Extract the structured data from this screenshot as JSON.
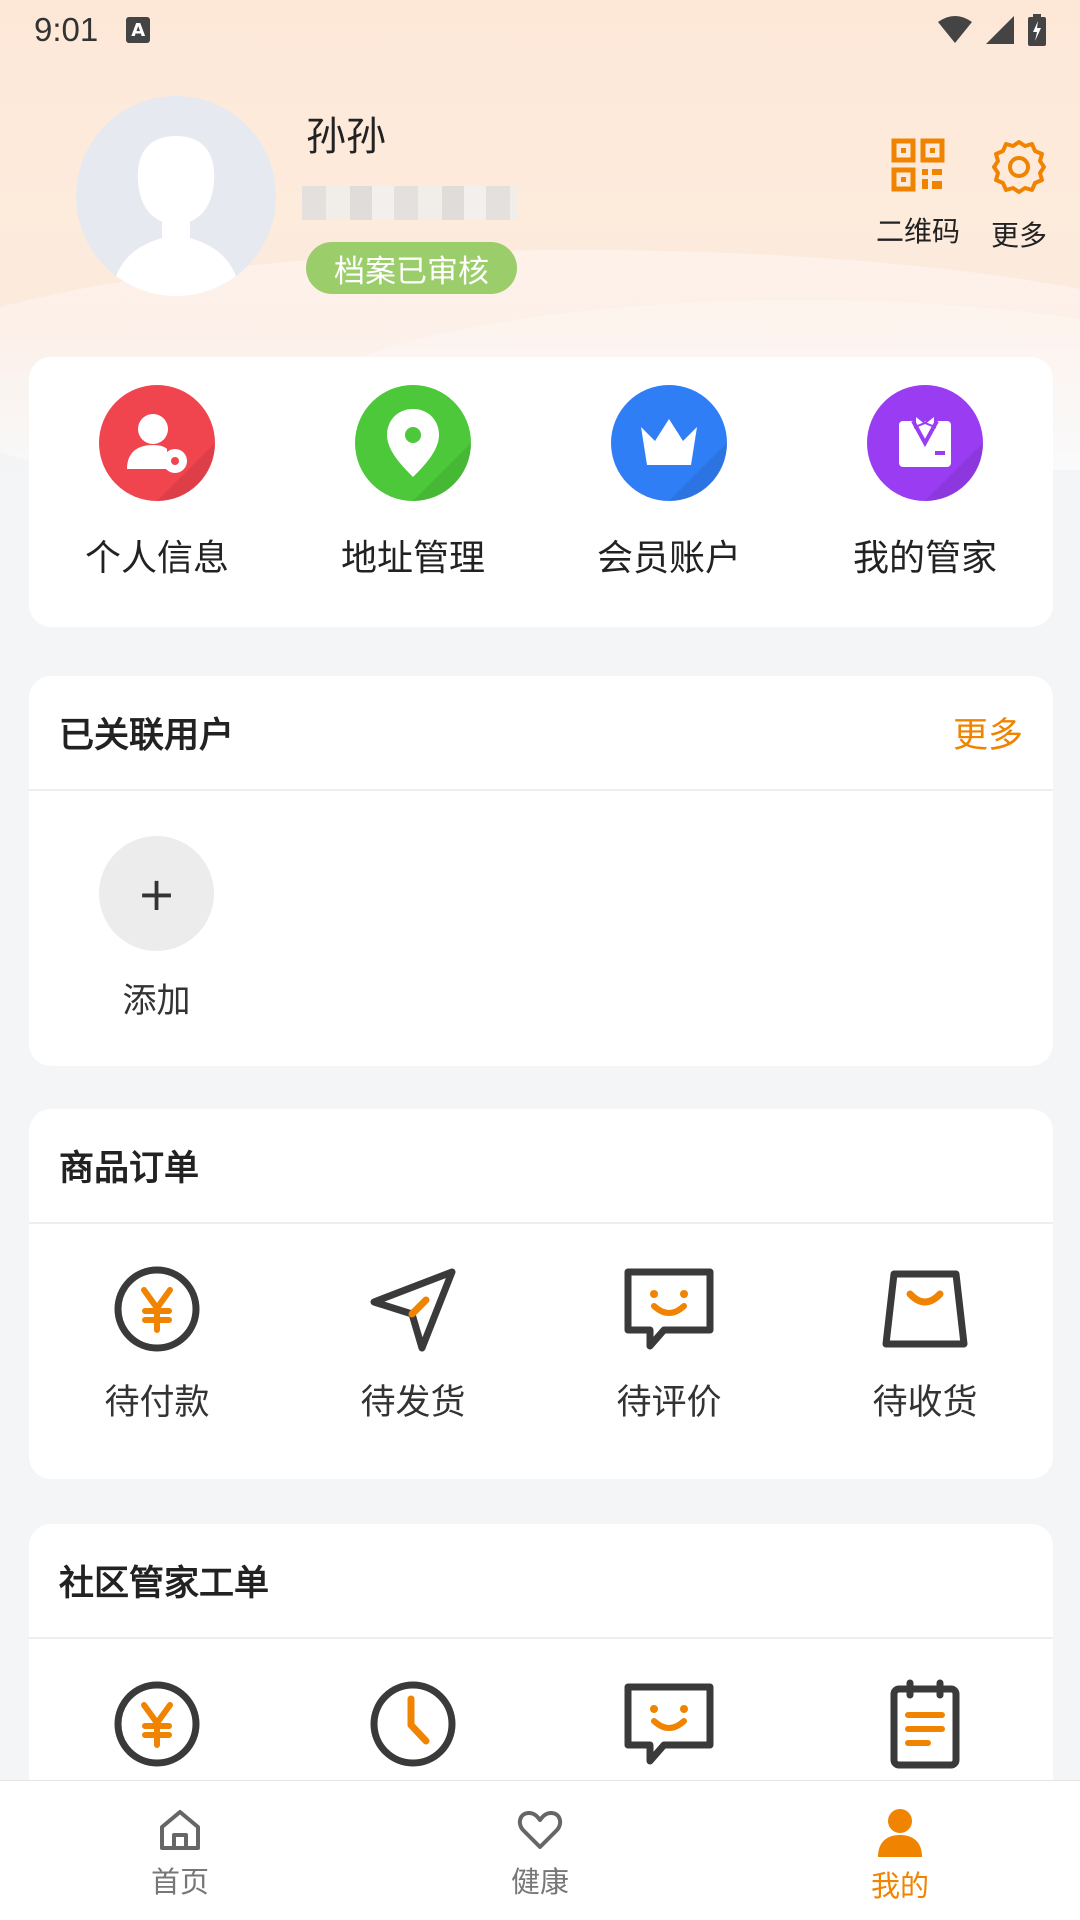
{
  "status_bar": {
    "time": "9:01",
    "notification_icon": "A"
  },
  "profile": {
    "name": "孙孙",
    "verified_badge": "档案已审核",
    "qr_label": "二维码",
    "more_label": "更多"
  },
  "quick_actions": [
    {
      "label": "个人信息",
      "icon": "person-settings-icon",
      "color": "#f0444f"
    },
    {
      "label": "地址管理",
      "icon": "location-pin-icon",
      "color": "#4cc83a"
    },
    {
      "label": "会员账户",
      "icon": "crown-icon",
      "color": "#2f7ef6"
    },
    {
      "label": "我的管家",
      "icon": "butler-icon",
      "color": "#9a3cf2"
    }
  ],
  "linked_users": {
    "title": "已关联用户",
    "more": "更多",
    "add_label": "添加",
    "add_symbol": "+"
  },
  "orders": {
    "title": "商品订单",
    "items": [
      {
        "label": "待付款",
        "icon": "yuan-icon"
      },
      {
        "label": "待发货",
        "icon": "send-icon"
      },
      {
        "label": "待评价",
        "icon": "review-icon"
      },
      {
        "label": "待收货",
        "icon": "shopping-bag-icon"
      }
    ]
  },
  "community": {
    "title": "社区管家工单",
    "items": [
      {
        "icon": "yuan-icon"
      },
      {
        "icon": "clock-icon"
      },
      {
        "icon": "review-icon"
      },
      {
        "icon": "clipboard-icon"
      }
    ]
  },
  "tabbar": [
    {
      "label": "首页",
      "icon": "home-icon"
    },
    {
      "label": "健康",
      "icon": "heart-icon"
    },
    {
      "label": "我的",
      "icon": "user-icon",
      "active": true
    }
  ],
  "colors": {
    "accent": "#f08300",
    "badge": "#9ccd6b",
    "icon_dark": "#3a3a3a"
  }
}
